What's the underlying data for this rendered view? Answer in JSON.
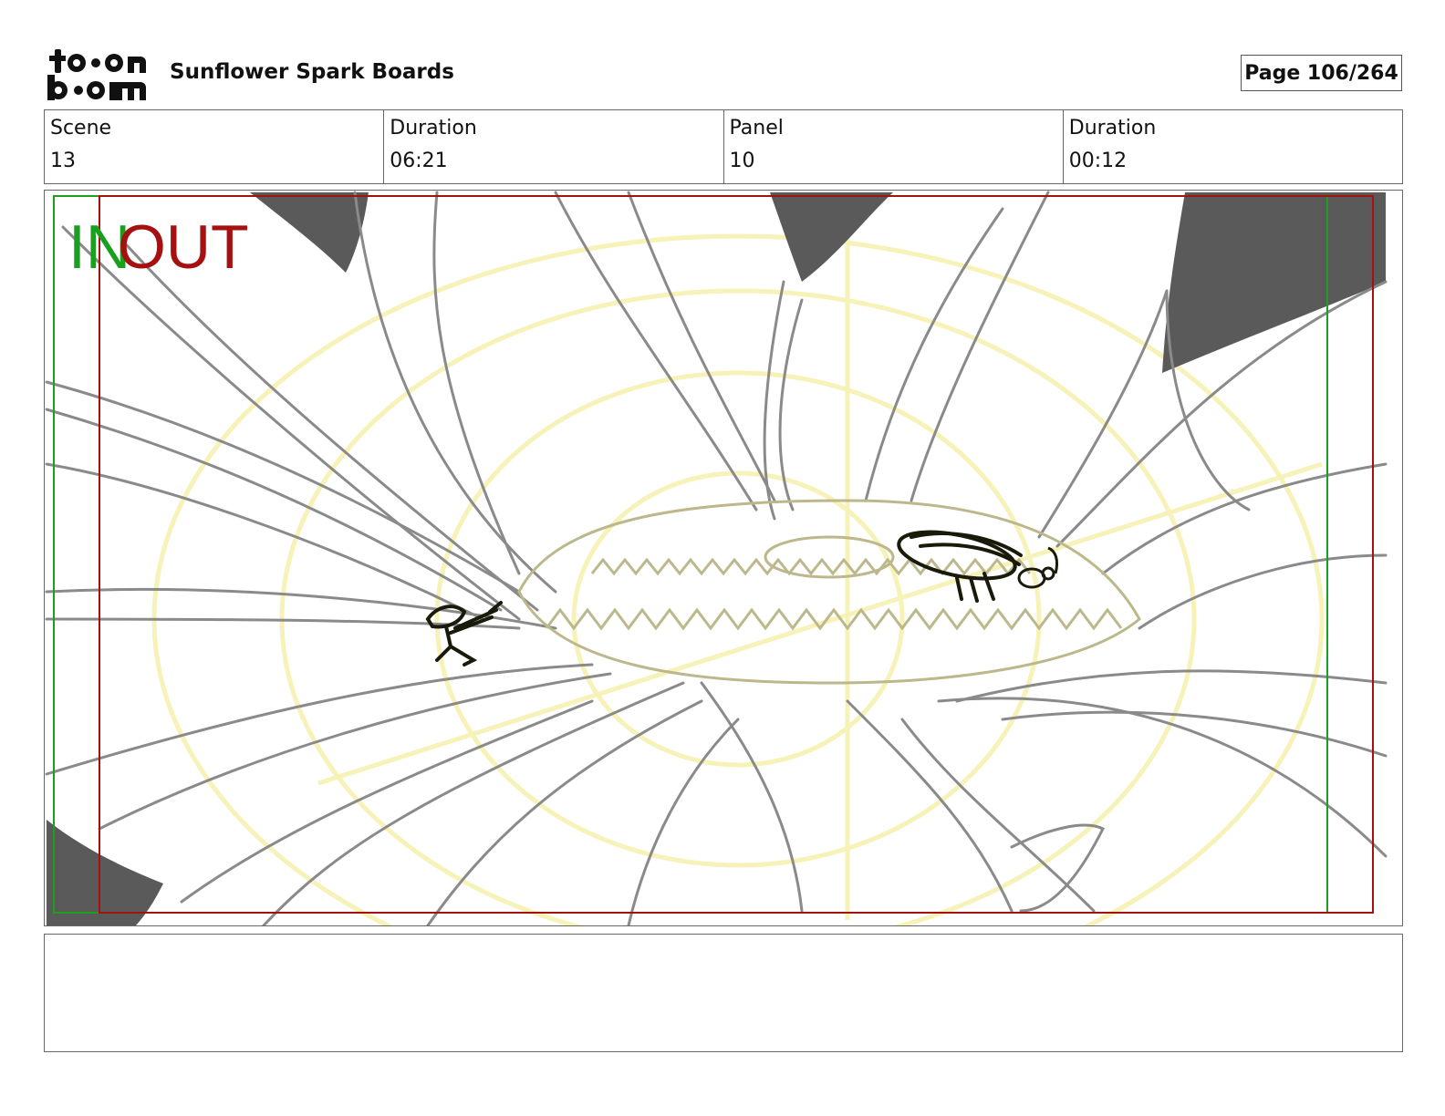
{
  "header": {
    "logo_alt": "toon boom",
    "project_title": "Sunflower Spark Boards",
    "page_label": "Page 106/264"
  },
  "info": [
    {
      "label": "Scene",
      "value": "13"
    },
    {
      "label": "Duration",
      "value": "06:21"
    },
    {
      "label": "Panel",
      "value": "10"
    },
    {
      "label": "Duration",
      "value": "00:12"
    }
  ],
  "panel": {
    "in_marker": "IN",
    "out_marker": "OUT",
    "colors": {
      "in_frame": "#18a01e",
      "out_frame": "#a61010",
      "sketch_line": "#8a8a8a",
      "shadow_fill": "#5a5a5a",
      "guide_yellow": "#f6f2b8",
      "character_ink": "#1a1a0a"
    }
  },
  "notes": {
    "text": ""
  }
}
